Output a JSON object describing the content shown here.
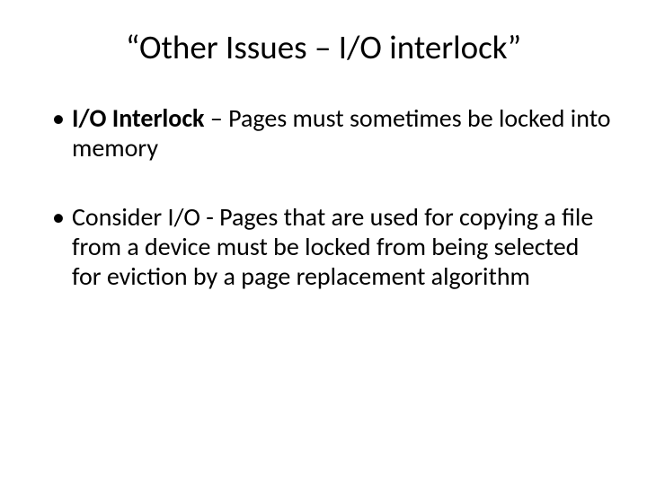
{
  "title": "“Other Issues – I/O interlock”",
  "bullets": [
    {
      "lead": "I/O Interlock ",
      "rest": "– Pages must sometimes be locked into memory"
    },
    {
      "lead": "",
      "rest": "Consider I/O - Pages that are used for copying a file from a device must be locked from being selected for eviction by a page replacement algorithm"
    }
  ]
}
